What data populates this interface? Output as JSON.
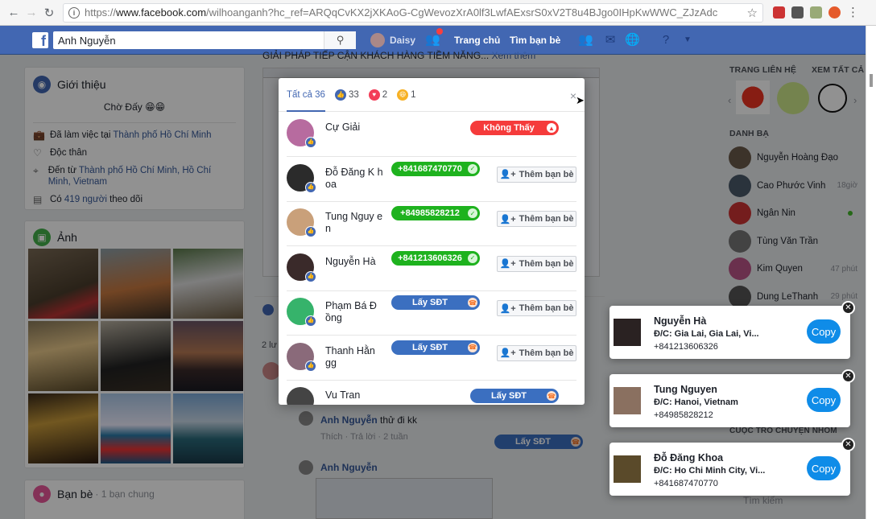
{
  "browser": {
    "url_prefix": "https://",
    "url_host": "www.facebook.com",
    "url_path": "/wilhoanganh?hc_ref=ARQqCvKX2jXKAoG-CgWevozXrA0lf3LwfAExsrS0xV2T8u4BJgo0IHpKwWWC_ZJzAdc",
    "icons": [
      "back-icon",
      "forward-icon",
      "reload-icon",
      "info-icon",
      "star-icon",
      "menu-dots-icon"
    ]
  },
  "header": {
    "search_value": "Anh Nguyễn",
    "user_name": "Daisy",
    "home_label": "Trang chủ",
    "find_friends_label": "Tìm bạn bè"
  },
  "intro": {
    "title": "Giới thiệu",
    "status": "Chờ Đấy 😁😁",
    "work_prefix": "Đã làm việc tại ",
    "work_place": "Thành phố Hồ Chí Minh",
    "relationship": "Độc thân",
    "from_prefix": "Đến từ ",
    "from_place": "Thành phố Hồ Chí Minh, Hồ Chí Minh, Vietnam",
    "followers_prefix": "Có ",
    "followers_count": "419 người",
    "followers_suffix": " theo dõi"
  },
  "photos": {
    "title": "Ảnh"
  },
  "friends": {
    "title": "Bạn bè",
    "subtitle": "· 1 bạn chung"
  },
  "post": {
    "snippet": "GIẢI PHÁP TIẾP CẬN KHÁCH HÀNG TIỀM NĂNG...",
    "see_more": "Xem thêm",
    "side_count": "2 lư",
    "comment1_name": "Anh Nguyễn",
    "comment1_text": " thử đi kk",
    "comment1_actions": "Thích · Trả lời · 2 tuần",
    "comment2_name": "Anh Nguyễn",
    "comment_get_phone": "Lấy SĐT"
  },
  "modal": {
    "tab_all": "Tất cả 36",
    "like_count": "33",
    "love_count": "2",
    "haha_count": "1",
    "close": "×",
    "add_friend": "Thêm bạn bè",
    "rows": [
      {
        "name": "Cự Giải",
        "pill": "Không Thấy",
        "pill_style": "red"
      },
      {
        "name": "Đỗ Đăng K hoa",
        "pill": "+841687470770",
        "pill_style": "green"
      },
      {
        "name": "Tung Nguy en",
        "pill": "+84985828212",
        "pill_style": "green"
      },
      {
        "name": "Nguyễn Hà",
        "pill": "+841213606326",
        "pill_style": "green"
      },
      {
        "name": "Phạm Bá Đ ồng",
        "pill": "Lấy SĐT",
        "pill_style": "blue"
      },
      {
        "name": "Thanh Hằn gg",
        "pill": "Lấy SĐT",
        "pill_style": "blue"
      },
      {
        "name": "Vu Tran",
        "pill": "Lấy SĐT",
        "pill_style": "blue"
      }
    ]
  },
  "right": {
    "pages_title": "TRANG LIÊN HỆ",
    "see_all": "XEM TẤT CẢ",
    "directory_title": "DANH BẠ",
    "contacts": [
      {
        "name": "Nguyễn Hoàng Đạo",
        "time": ""
      },
      {
        "name": "Cao Phước Vinh",
        "time": "18giờ"
      },
      {
        "name": "Ngân Nin",
        "time": ""
      },
      {
        "name": "Tùng Văn Trần",
        "time": ""
      },
      {
        "name": "Kim Quyen",
        "time": "47 phút"
      },
      {
        "name": "Dung LeThanh",
        "time": "29 phút"
      }
    ],
    "more_chats": "CUỘC TRÒ CHUYỆN NHÓM",
    "search_placeholder": "Tìm kiếm"
  },
  "popups": [
    {
      "name": "Nguyễn Hà",
      "address": "Đ/C: Gia Lai, Gia Lai, Vi...",
      "phone": "+841213606326",
      "copy": "Copy"
    },
    {
      "name": "Tung Nguyen",
      "address": "Đ/C: Hanoi, Vietnam",
      "phone": "+84985828212",
      "copy": "Copy"
    },
    {
      "name": "Đỗ Đăng Khoa",
      "address": "Đ/C: Ho Chi Minh City, Vi...",
      "phone": "+841687470770",
      "copy": "Copy"
    }
  ],
  "colors": {
    "fb_blue": "#4267b2",
    "green_pill": "#1eb21e",
    "blue_pill": "#3b6fc0",
    "red_pill": "#f53b3b",
    "copy_button": "#0f8ce8"
  }
}
